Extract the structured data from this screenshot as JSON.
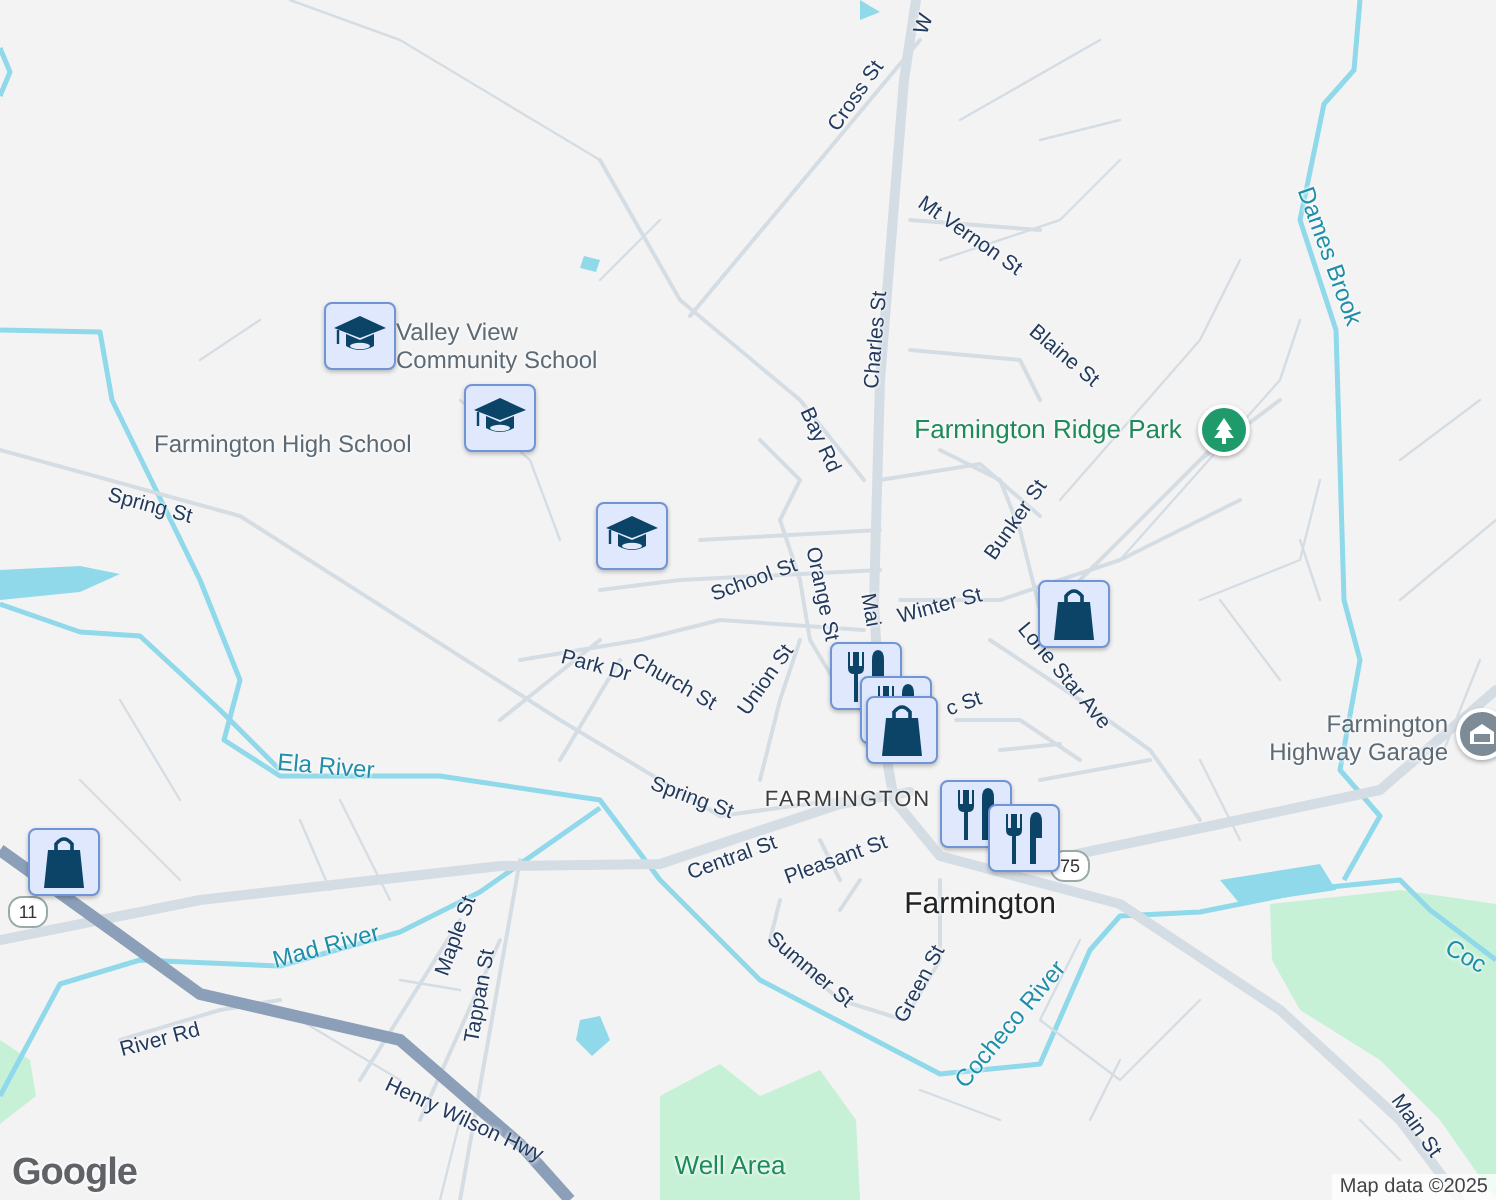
{
  "labels": [
    {
      "text": "W",
      "kind": "street"
    },
    {
      "text": "Cross St",
      "kind": "street"
    },
    {
      "text": "Mt Vernon St",
      "kind": "street"
    },
    {
      "text": "Blaine St",
      "kind": "street"
    },
    {
      "text": "Valley View Community School",
      "kind": "poi"
    },
    {
      "text": "Farmington High School",
      "kind": "poi"
    },
    {
      "text": "Bay Rd",
      "kind": "street"
    },
    {
      "text": "Charles St",
      "kind": "street"
    },
    {
      "text": "Farmington Ridge Park",
      "kind": "park"
    },
    {
      "text": "Dames Brook",
      "kind": "water"
    },
    {
      "text": "Spring St",
      "kind": "street"
    },
    {
      "text": "Bunker St",
      "kind": "street"
    },
    {
      "text": "School St",
      "kind": "street"
    },
    {
      "text": "Orange St",
      "kind": "street"
    },
    {
      "text": "Winter St",
      "kind": "street"
    },
    {
      "text": "Lone Star Ave",
      "kind": "street"
    },
    {
      "text": "Park Dr",
      "kind": "street"
    },
    {
      "text": "Church St",
      "kind": "street"
    },
    {
      "text": "Union St",
      "kind": "street"
    },
    {
      "text": "Mai",
      "kind": "street"
    },
    {
      "text": "c St",
      "kind": "street"
    },
    {
      "text": "Farmington Highway Garage",
      "kind": "poi"
    },
    {
      "text": "Ela River",
      "kind": "water"
    },
    {
      "text": "FARMINGTON",
      "kind": "place"
    },
    {
      "text": "Spring St",
      "kind": "street"
    },
    {
      "text": "Central St",
      "kind": "street"
    },
    {
      "text": "Pleasant St",
      "kind": "street"
    },
    {
      "text": "Farmington",
      "kind": "town"
    },
    {
      "text": "Summer St",
      "kind": "street"
    },
    {
      "text": "Green St",
      "kind": "street"
    },
    {
      "text": "Mad River",
      "kind": "water"
    },
    {
      "text": "Maple St",
      "kind": "street"
    },
    {
      "text": "Tappan St",
      "kind": "street"
    },
    {
      "text": "River Rd",
      "kind": "street"
    },
    {
      "text": "Henry Wilson Hwy",
      "kind": "street"
    },
    {
      "text": "Cocheco River",
      "kind": "water"
    },
    {
      "text": "Coc",
      "kind": "water"
    },
    {
      "text": "Well Area",
      "kind": "park"
    },
    {
      "text": "Main St",
      "kind": "street"
    }
  ],
  "shields": [
    "11",
    "75"
  ],
  "markers": [
    {
      "kind": "school"
    },
    {
      "kind": "school"
    },
    {
      "kind": "school"
    },
    {
      "kind": "shop"
    },
    {
      "kind": "shop"
    },
    {
      "kind": "restaurant"
    },
    {
      "kind": "restaurant"
    },
    {
      "kind": "shop"
    },
    {
      "kind": "restaurant"
    },
    {
      "kind": "restaurant"
    }
  ],
  "pois": [
    {
      "kind": "park"
    },
    {
      "kind": "garage"
    }
  ],
  "logo": "Google",
  "attribution": "Map data ©2025"
}
